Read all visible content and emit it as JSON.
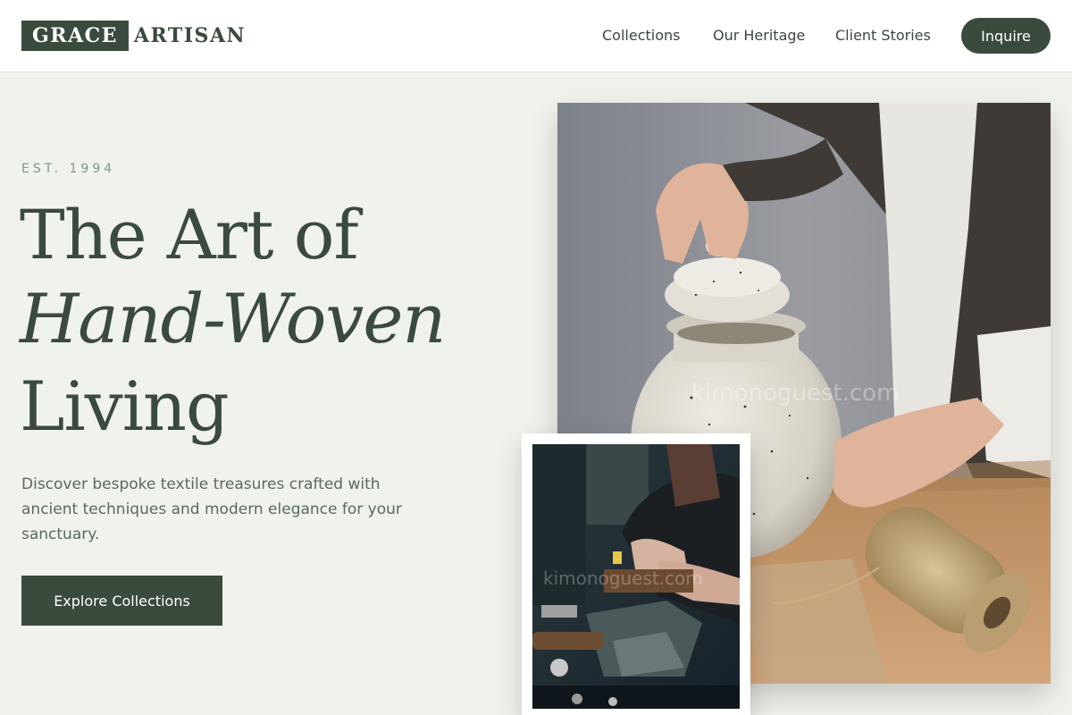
{
  "brand": {
    "logo_box": "GRACE",
    "logo_rest": "ARTISAN"
  },
  "nav": {
    "items": [
      {
        "label": "Collections"
      },
      {
        "label": "Our Heritage"
      },
      {
        "label": "Client Stories"
      }
    ],
    "cta_label": "Inquire"
  },
  "hero": {
    "eyebrow": "EST. 1994",
    "title_line_1": "The Art of",
    "title_line_2": "Hand-Woven",
    "title_line_3": "Living",
    "description": "Discover bespoke textile treasures crafted with ancient techniques and modern elegance for your sanctuary.",
    "button_label": "Explore Collections"
  },
  "images": {
    "main_watermark": "kimonoguest.com",
    "small_watermark": "kimonoguest.com",
    "main_icon": "pottery-artisan-photo",
    "small_icon": "jeweler-workbench-photo"
  },
  "colors": {
    "brand_dark": "#3a4a3c",
    "background": "#f0f2ec",
    "accent_sage": "#7f9a80",
    "text_muted": "#5a6a5d"
  }
}
